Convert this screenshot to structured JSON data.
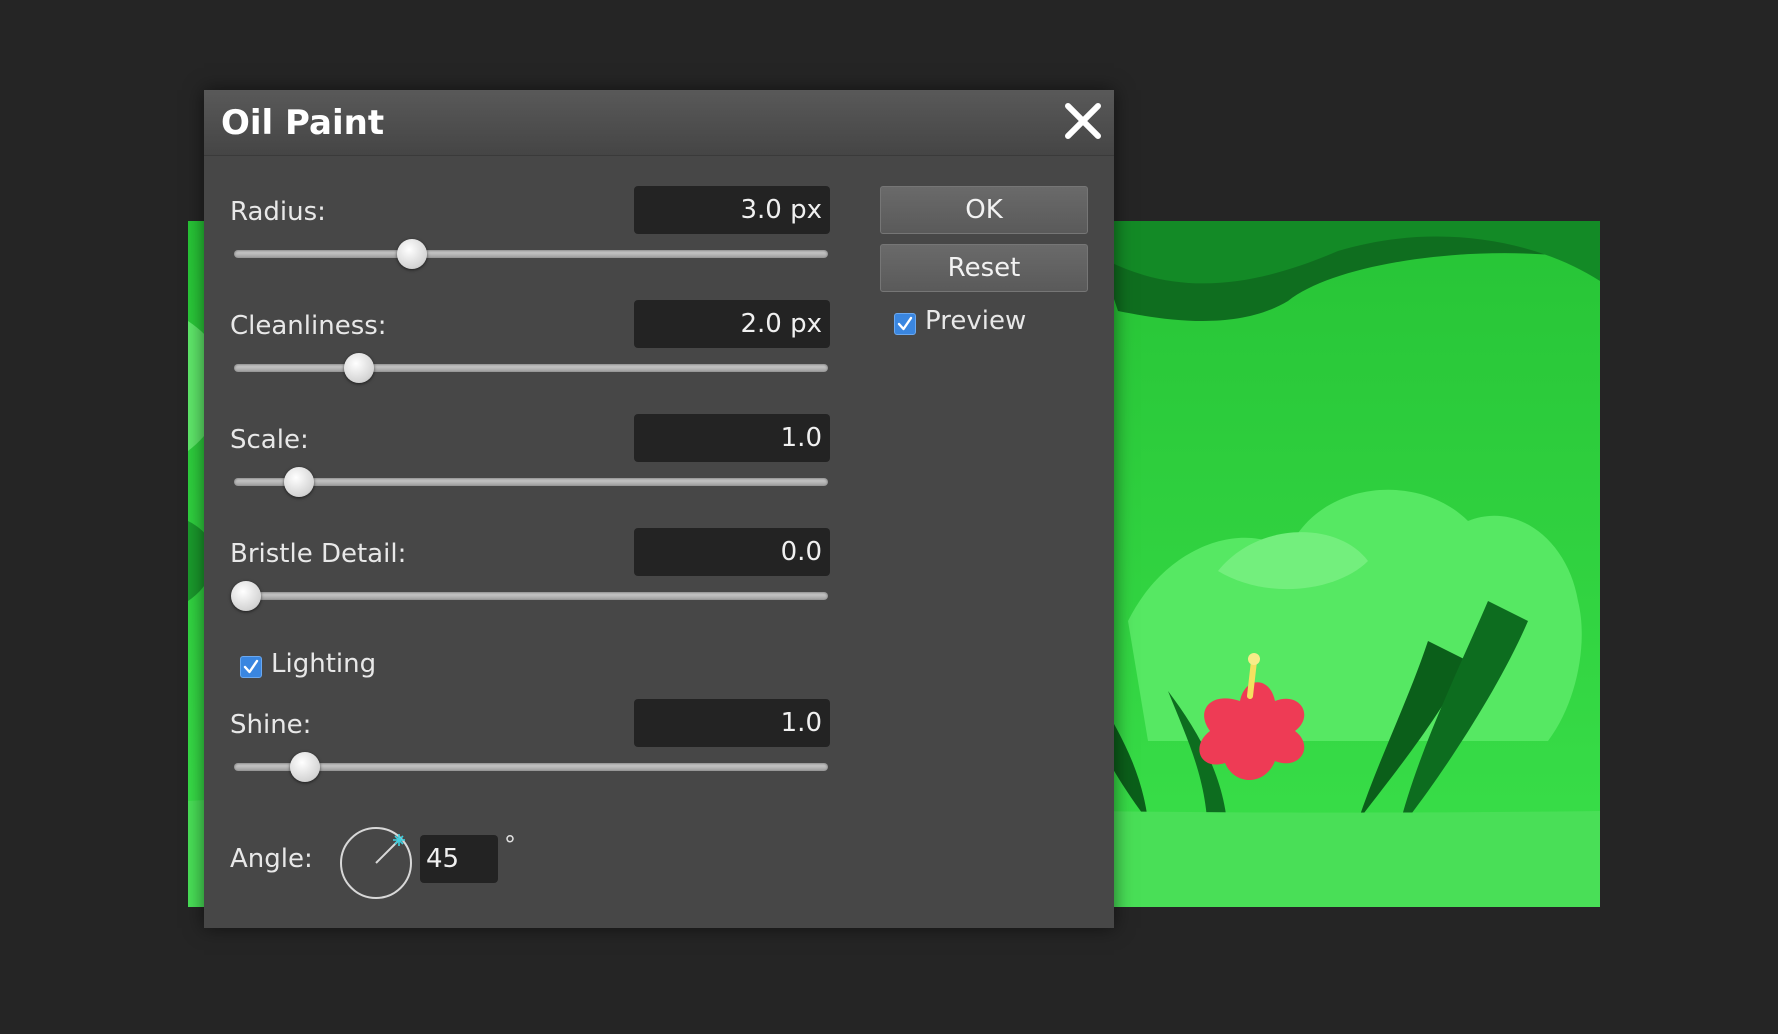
{
  "dialog": {
    "title": "Oil Paint",
    "close_icon": "close-icon"
  },
  "params": {
    "radius": {
      "label": "Radius:",
      "value": "3.0 px",
      "level": 0.3
    },
    "cleanliness": {
      "label": "Cleanliness:",
      "value": "2.0 px",
      "level": 0.21
    },
    "scale": {
      "label": "Scale:",
      "value": "1.0",
      "level": 0.11
    },
    "bristle_detail": {
      "label": "Bristle Detail:",
      "value": "0.0",
      "level": 0.02
    },
    "shine": {
      "label": "Shine:",
      "value": "1.0",
      "level": 0.12
    },
    "angle": {
      "label": "Angle:",
      "value": "45",
      "unit": "°"
    }
  },
  "lighting": {
    "label": "Lighting",
    "checked": true
  },
  "buttons": {
    "ok": "OK",
    "reset": "Reset"
  },
  "preview": {
    "label": "Preview",
    "checked": true
  },
  "colors": {
    "dialog_bg": "#474747",
    "input_bg": "#232323",
    "checkbox_accent": "#3a86e0",
    "page_bg": "#252525"
  }
}
